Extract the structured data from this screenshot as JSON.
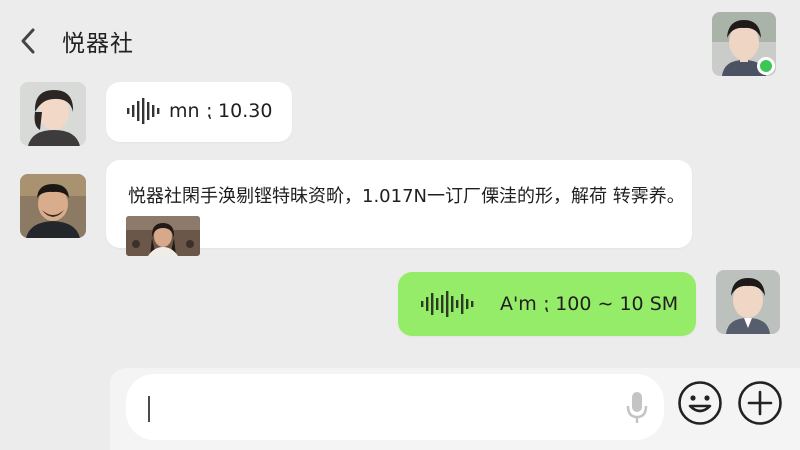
{
  "header": {
    "title": "悦器社",
    "back_icon": "chevron-left-icon"
  },
  "messages": [
    {
      "side": "left",
      "type": "voice",
      "text": "mn ⁏ 10.30"
    },
    {
      "side": "left",
      "type": "text",
      "text": "悦器社閑手涣剔铿特昧资畍，1.017N一订厂傈洼的形，解荷 转霁养。"
    },
    {
      "side": "right",
      "type": "voice",
      "text": "A'm ⁏ 100 ∼ 10 SM"
    }
  ],
  "composer": {
    "input_value": "",
    "mic_icon": "microphone-icon",
    "emoji_icon": "smiley-icon",
    "plus_icon": "plus-circle-icon"
  },
  "colors": {
    "background": "#ececec",
    "bubble_incoming": "#ffffff",
    "bubble_outgoing": "#95ec69",
    "online": "#3cc655"
  }
}
